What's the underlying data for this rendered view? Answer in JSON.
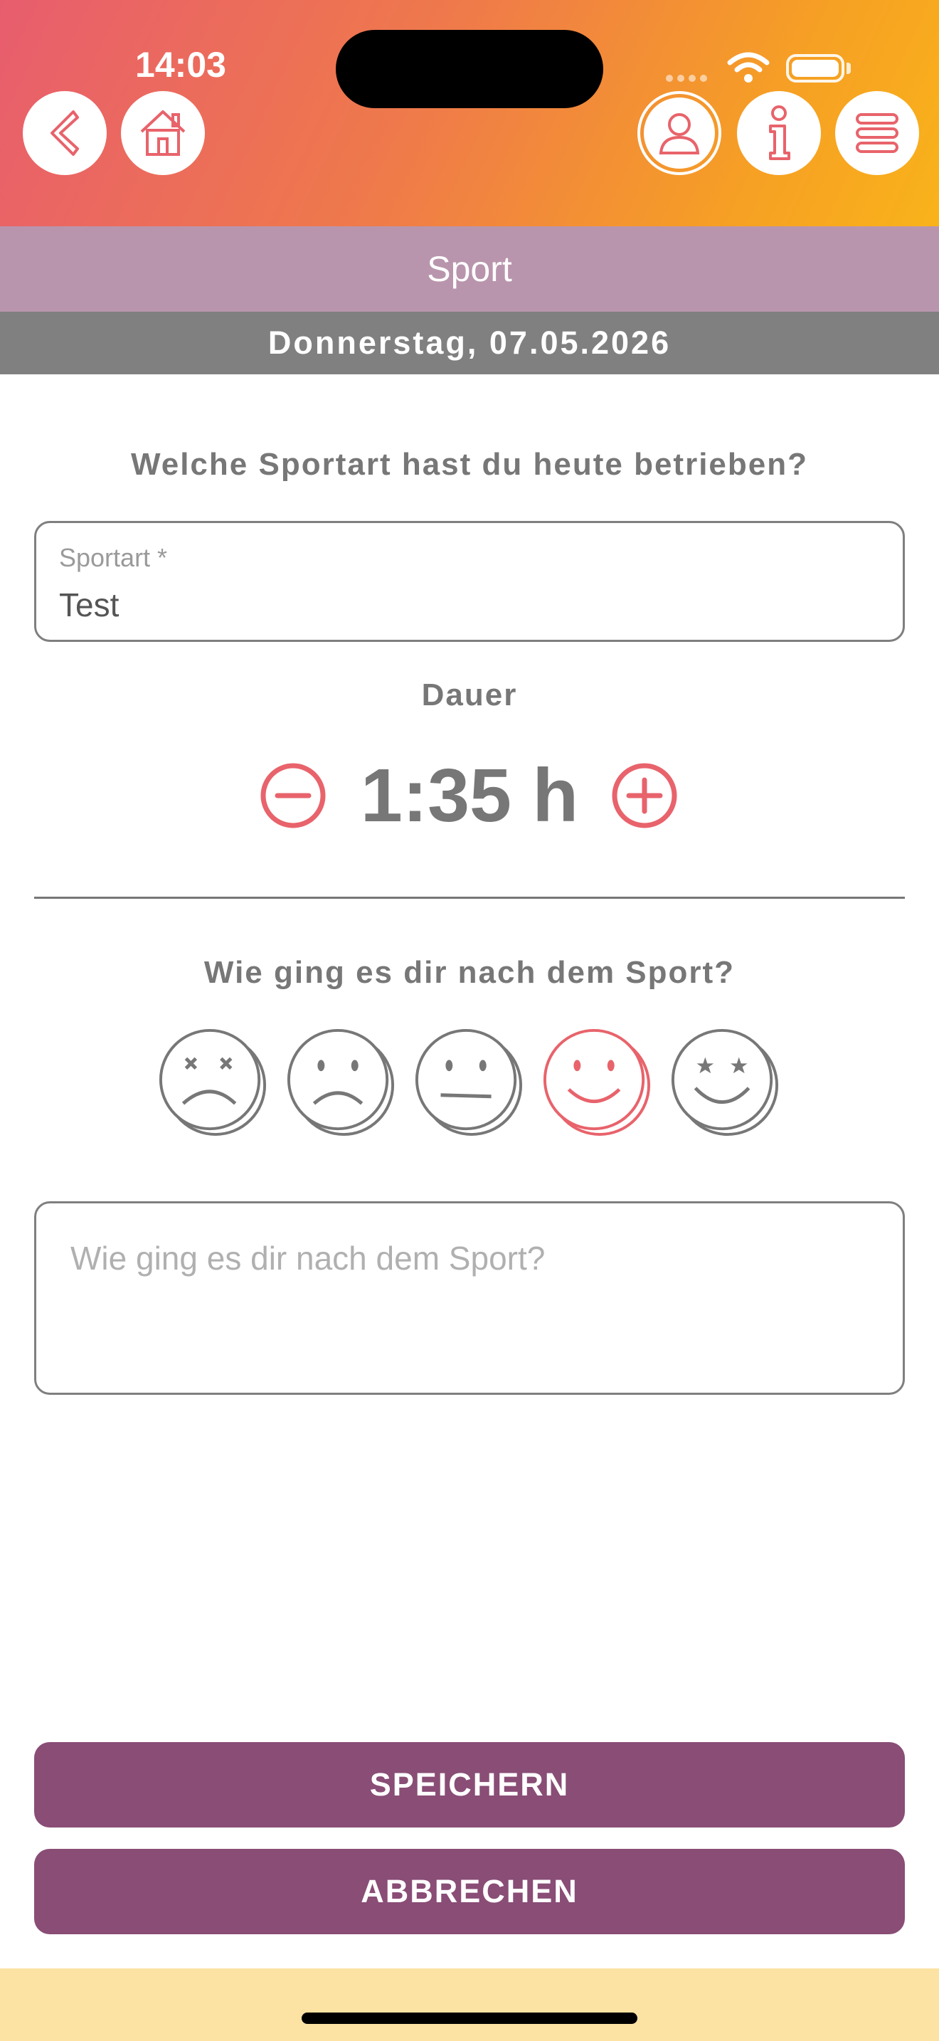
{
  "status_bar": {
    "time": "14:03"
  },
  "header": {
    "icons": [
      "back-icon",
      "home-icon",
      "profile-icon",
      "info-icon",
      "menu-icon"
    ]
  },
  "page": {
    "title": "Sport",
    "date": "Donnerstag, 07.05.2026"
  },
  "form": {
    "sport_question": "Welche Sportart hast du heute betrieben?",
    "sport_field": {
      "label": "Sportart *",
      "value": "Test"
    },
    "duration_label": "Dauer",
    "duration_value": "1:35 h",
    "mood_question": "Wie ging es dir nach dem Sport?",
    "moods": [
      "very-bad",
      "bad",
      "neutral",
      "good",
      "very-good"
    ],
    "selected_mood": "good",
    "notes_placeholder": "Wie ging es dir nach dem Sport?"
  },
  "actions": {
    "save_label": "SPEICHERN",
    "cancel_label": "ABBRECHEN"
  },
  "colors": {
    "accent": "#e8636b",
    "button": "#894d76",
    "title_bar": "#b995ad",
    "date_bar": "#808080",
    "bottom_bar": "#fce3a3"
  }
}
